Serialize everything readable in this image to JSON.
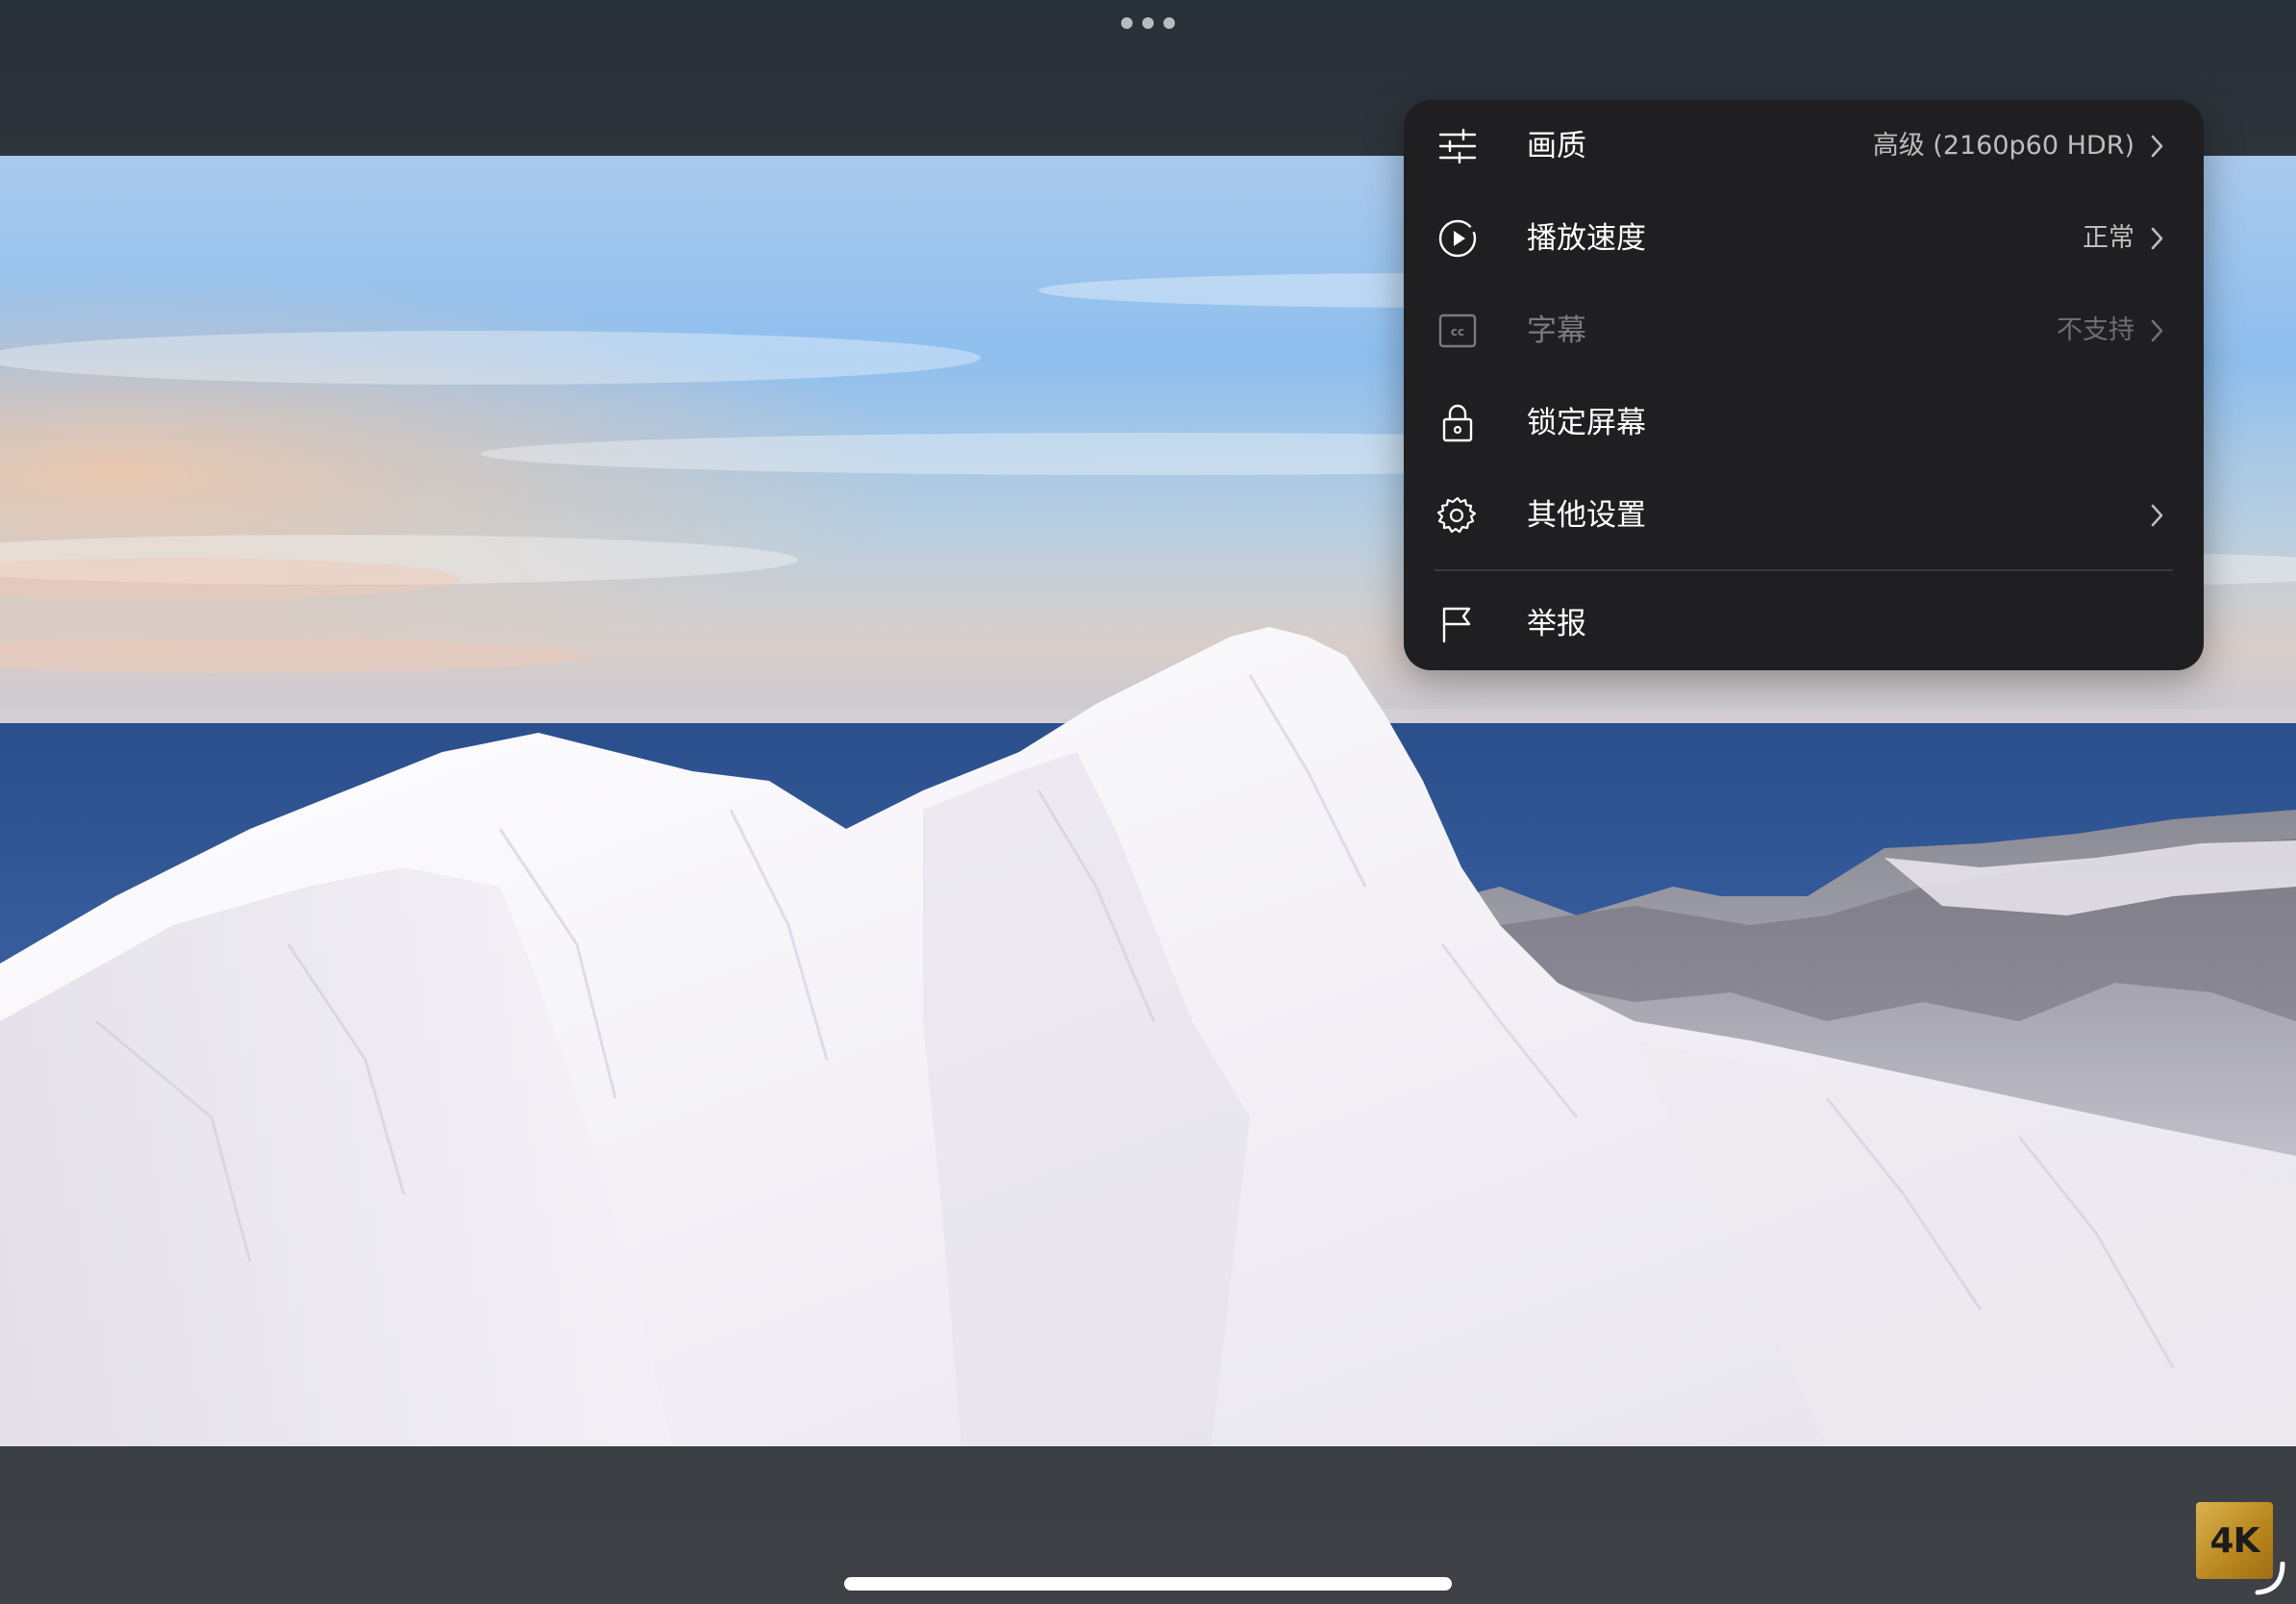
{
  "menu": {
    "items": [
      {
        "label": "画质",
        "value": "高级 (2160p60 HDR)",
        "icon": "sliders-icon"
      },
      {
        "label": "播放速度",
        "value": "正常",
        "icon": "play-circle-icon"
      },
      {
        "label": "字幕",
        "value": "不支持",
        "icon": "cc-icon"
      },
      {
        "label": "锁定屏幕",
        "value": "",
        "icon": "lock-icon"
      },
      {
        "label": "其他设置",
        "value": "",
        "icon": "gear-icon"
      },
      {
        "label": "举报",
        "value": "",
        "icon": "flag-icon"
      }
    ]
  },
  "badge": {
    "text": "4K"
  },
  "colors": {
    "menu_bg": "#1f1f21",
    "menu_text": "#ffffff",
    "menu_value": "#bdbdbd",
    "disabled_text": "#7a7a7c",
    "badge_gold": "#c9992f"
  }
}
